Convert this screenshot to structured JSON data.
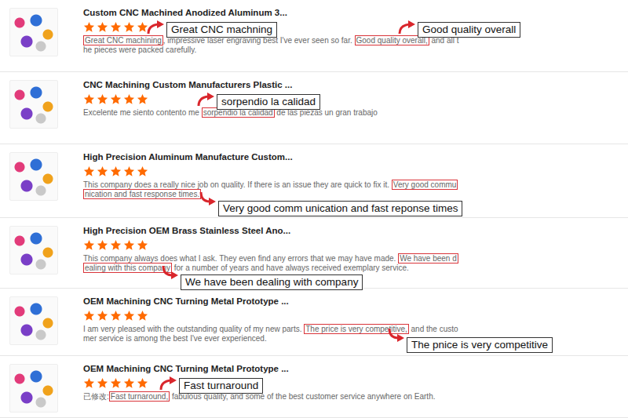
{
  "reviews": [
    {
      "title": "Custom CNC Machined Anodized Aluminum 3...",
      "stars": 5,
      "body": [
        {
          "text": "Great CNC machining",
          "highlighted": true
        },
        {
          "text": ", impressive laser engraving best I've ever seen so far. ",
          "highlighted": false
        },
        {
          "text": "Good quality overall,",
          "highlighted": true
        },
        {
          "text": " and all the pieces were packed carefully.",
          "highlighted": false
        }
      ],
      "callouts": [
        "Great CNC machning",
        "Good quality overall"
      ]
    },
    {
      "title": "CNC Machining Custom Manufacturers Plastic ...",
      "stars": 5,
      "body": [
        {
          "text": "Excelente me siento contento me ",
          "highlighted": false
        },
        {
          "text": "sorpendio la calidad",
          "highlighted": true
        },
        {
          "text": " de las piezas un gran trabajo",
          "highlighted": false
        }
      ],
      "callouts": [
        "sorpendio la calidad"
      ]
    },
    {
      "title": "High Precision Aluminum Manufacture Custom...",
      "stars": 5,
      "body": [
        {
          "text": "This company does a really nice job on quality.  If there is an issue they are quick to fix it. ",
          "highlighted": false
        },
        {
          "text": "Very good communication and fast response times.",
          "highlighted": true
        }
      ],
      "callouts": [
        "Very good comm unication and fast reponse times"
      ]
    },
    {
      "title": "High Precision OEM Brass Stainless Steel Ano...",
      "stars": 5,
      "body": [
        {
          "text": "This company always does what I ask.  They even find any errors that we may have made. ",
          "highlighted": false
        },
        {
          "text": "We have been dealing with this company",
          "highlighted": true
        },
        {
          "text": " for a number of years and have always received exemplary service.",
          "highlighted": false
        }
      ],
      "callouts": [
        "We have been dealing with company"
      ]
    },
    {
      "title": "OEM Machining CNC Turning Metal Prototype ...",
      "stars": 5,
      "body": [
        {
          "text": "I am very pleased with the outstanding quality of my new parts. ",
          "highlighted": false
        },
        {
          "text": "The price is very competitive,",
          "highlighted": true
        },
        {
          "text": " and the customer service is among the best I've ever experienced.",
          "highlighted": false
        }
      ],
      "callouts": [
        "The pnice is very competitive"
      ]
    },
    {
      "title": "OEM Machining CNC Turning Metal Prototype ...",
      "stars": 5,
      "body": [
        {
          "text": "已修改:",
          "highlighted": false
        },
        {
          "text": "Fast turnaround,",
          "highlighted": true
        },
        {
          "text": " fabulous quality, and some of the best customer service anywhere on Earth.",
          "highlighted": false
        }
      ],
      "callouts": [
        "Fast turnaround"
      ]
    }
  ]
}
